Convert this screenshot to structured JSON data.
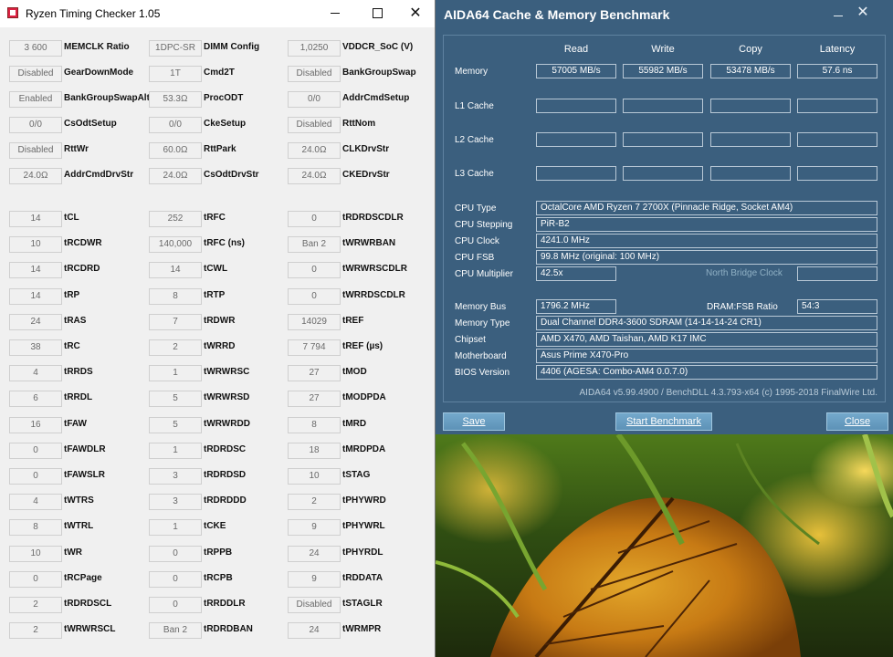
{
  "rtc": {
    "title": "Ryzen Timing Checker 1.05",
    "rows": [
      {
        "c": [
          {
            "v": "3 600",
            "l": "MEMCLK Ratio"
          },
          {
            "v": "1DPC-SR",
            "l": "DIMM Config"
          },
          {
            "v": "1,0250",
            "l": "VDDCR_SoC (V)"
          }
        ]
      },
      {
        "c": [
          {
            "v": "Disabled",
            "l": "GearDownMode"
          },
          {
            "v": "1T",
            "l": "Cmd2T"
          },
          {
            "v": "Disabled",
            "l": "BankGroupSwap"
          }
        ]
      },
      {
        "c": [
          {
            "v": "Enabled",
            "l": "BankGroupSwapAlt"
          },
          {
            "v": "53.3Ω",
            "l": "ProcODT"
          },
          {
            "v": "0/0",
            "l": "AddrCmdSetup"
          }
        ]
      },
      {
        "c": [
          {
            "v": "0/0",
            "l": "CsOdtSetup"
          },
          {
            "v": "0/0",
            "l": "CkeSetup"
          },
          {
            "v": "Disabled",
            "l": "RttNom"
          }
        ]
      },
      {
        "c": [
          {
            "v": "Disabled",
            "l": "RttWr"
          },
          {
            "v": "60.0Ω",
            "l": "RttPark"
          },
          {
            "v": "24.0Ω",
            "l": "CLKDrvStr"
          }
        ]
      },
      {
        "c": [
          {
            "v": "24.0Ω",
            "l": "AddrCmdDrvStr"
          },
          {
            "v": "24.0Ω",
            "l": "CsOdtDrvStr"
          },
          {
            "v": "24.0Ω",
            "l": "CKEDrvStr"
          }
        ]
      },
      {
        "c": [
          {
            "v": "14",
            "l": "tCL"
          },
          {
            "v": "252",
            "l": "tRFC"
          },
          {
            "v": "0",
            "l": "tRDRDSCDLR"
          }
        ]
      },
      {
        "c": [
          {
            "v": "10",
            "l": "tRCDWR"
          },
          {
            "v": "140,000",
            "l": "tRFC (ns)"
          },
          {
            "v": "Ban 2",
            "l": "tWRWRBAN"
          }
        ]
      },
      {
        "c": [
          {
            "v": "14",
            "l": "tRCDRD"
          },
          {
            "v": "14",
            "l": "tCWL"
          },
          {
            "v": "0",
            "l": "tWRWRSCDLR"
          }
        ]
      },
      {
        "c": [
          {
            "v": "14",
            "l": "tRP"
          },
          {
            "v": "8",
            "l": "tRTP"
          },
          {
            "v": "0",
            "l": "tWRRDSCDLR"
          }
        ]
      },
      {
        "c": [
          {
            "v": "24",
            "l": "tRAS"
          },
          {
            "v": "7",
            "l": "tRDWR"
          },
          {
            "v": "14029",
            "l": "tREF"
          }
        ]
      },
      {
        "c": [
          {
            "v": "38",
            "l": "tRC"
          },
          {
            "v": "2",
            "l": "tWRRD"
          },
          {
            "v": "7 794",
            "l": "tREF (µs)"
          }
        ]
      },
      {
        "c": [
          {
            "v": "4",
            "l": "tRRDS"
          },
          {
            "v": "1",
            "l": "tWRWRSC"
          },
          {
            "v": "27",
            "l": "tMOD"
          }
        ]
      },
      {
        "c": [
          {
            "v": "6",
            "l": "tRRDL"
          },
          {
            "v": "5",
            "l": "tWRWRSD"
          },
          {
            "v": "27",
            "l": "tMODPDA"
          }
        ]
      },
      {
        "c": [
          {
            "v": "16",
            "l": "tFAW"
          },
          {
            "v": "5",
            "l": "tWRWRDD"
          },
          {
            "v": "8",
            "l": "tMRD"
          }
        ]
      },
      {
        "c": [
          {
            "v": "0",
            "l": "tFAWDLR"
          },
          {
            "v": "1",
            "l": "tRDRDSC"
          },
          {
            "v": "18",
            "l": "tMRDPDA"
          }
        ]
      },
      {
        "c": [
          {
            "v": "0",
            "l": "tFAWSLR"
          },
          {
            "v": "3",
            "l": "tRDRDSD"
          },
          {
            "v": "10",
            "l": "tSTAG"
          }
        ]
      },
      {
        "c": [
          {
            "v": "4",
            "l": "tWTRS"
          },
          {
            "v": "3",
            "l": "tRDRDDD"
          },
          {
            "v": "2",
            "l": "tPHYWRD"
          }
        ]
      },
      {
        "c": [
          {
            "v": "8",
            "l": "tWTRL"
          },
          {
            "v": "1",
            "l": "tCKE"
          },
          {
            "v": "9",
            "l": "tPHYWRL"
          }
        ]
      },
      {
        "c": [
          {
            "v": "10",
            "l": "tWR"
          },
          {
            "v": "0",
            "l": "tRPPB"
          },
          {
            "v": "24",
            "l": "tPHYRDL"
          }
        ]
      },
      {
        "c": [
          {
            "v": "0",
            "l": "tRCPage"
          },
          {
            "v": "0",
            "l": "tRCPB"
          },
          {
            "v": "9",
            "l": "tRDDATA"
          }
        ]
      },
      {
        "c": [
          {
            "v": "2",
            "l": "tRDRDSCL"
          },
          {
            "v": "0",
            "l": "tRRDDLR"
          },
          {
            "v": "Disabled",
            "l": "tSTAGLR"
          }
        ]
      },
      {
        "c": [
          {
            "v": "2",
            "l": "tWRWRSCL"
          },
          {
            "v": "Ban 2",
            "l": "tRDRDBAN"
          },
          {
            "v": "24",
            "l": "tWRMPR"
          }
        ]
      }
    ]
  },
  "aida": {
    "title": "AIDA64 Cache & Memory Benchmark",
    "columns": [
      "Read",
      "Write",
      "Copy",
      "Latency"
    ],
    "rows": [
      {
        "label": "Memory",
        "values": [
          "57005 MB/s",
          "55982 MB/s",
          "53478 MB/s",
          "57.6 ns"
        ]
      },
      {
        "label": "L1 Cache",
        "values": [
          "",
          "",
          "",
          ""
        ]
      },
      {
        "label": "L2 Cache",
        "values": [
          "",
          "",
          "",
          ""
        ]
      },
      {
        "label": "L3 Cache",
        "values": [
          "",
          "",
          "",
          ""
        ]
      }
    ],
    "info": [
      {
        "label": "CPU Type",
        "value": "OctalCore AMD Ryzen 7 2700X  (Pinnacle Ridge, Socket AM4)"
      },
      {
        "label": "CPU Stepping",
        "value": "PiR-B2"
      },
      {
        "label": "CPU Clock",
        "value": "4241.0 MHz"
      },
      {
        "label": "CPU FSB",
        "value": "99.8 MHz  (original: 100 MHz)"
      },
      {
        "label": "CPU Multiplier",
        "value": "42.5x"
      }
    ],
    "north_bridge_clock_label": "North Bridge Clock",
    "north_bridge_clock_value": "",
    "memory_bus": {
      "label": "Memory Bus",
      "value": "1796.2 MHz"
    },
    "dram_fsb": {
      "label": "DRAM:FSB Ratio",
      "value": "54:3"
    },
    "info2": [
      {
        "label": "Memory Type",
        "value": "Dual Channel DDR4-3600 SDRAM  (14-14-14-24 CR1)"
      },
      {
        "label": "Chipset",
        "value": "AMD X470, AMD Taishan, AMD K17 IMC"
      },
      {
        "label": "Motherboard",
        "value": "Asus Prime X470-Pro"
      },
      {
        "label": "BIOS Version",
        "value": "4406  (AGESA: Combo-AM4 0.0.7.0)"
      }
    ],
    "footer": "AIDA64 v5.99.4900 / BenchDLL 4.3.793-x64  (c) 1995-2018 FinalWire Ltd.",
    "buttons": {
      "save": "Save",
      "start": "Start Benchmark",
      "close": "Close"
    }
  }
}
